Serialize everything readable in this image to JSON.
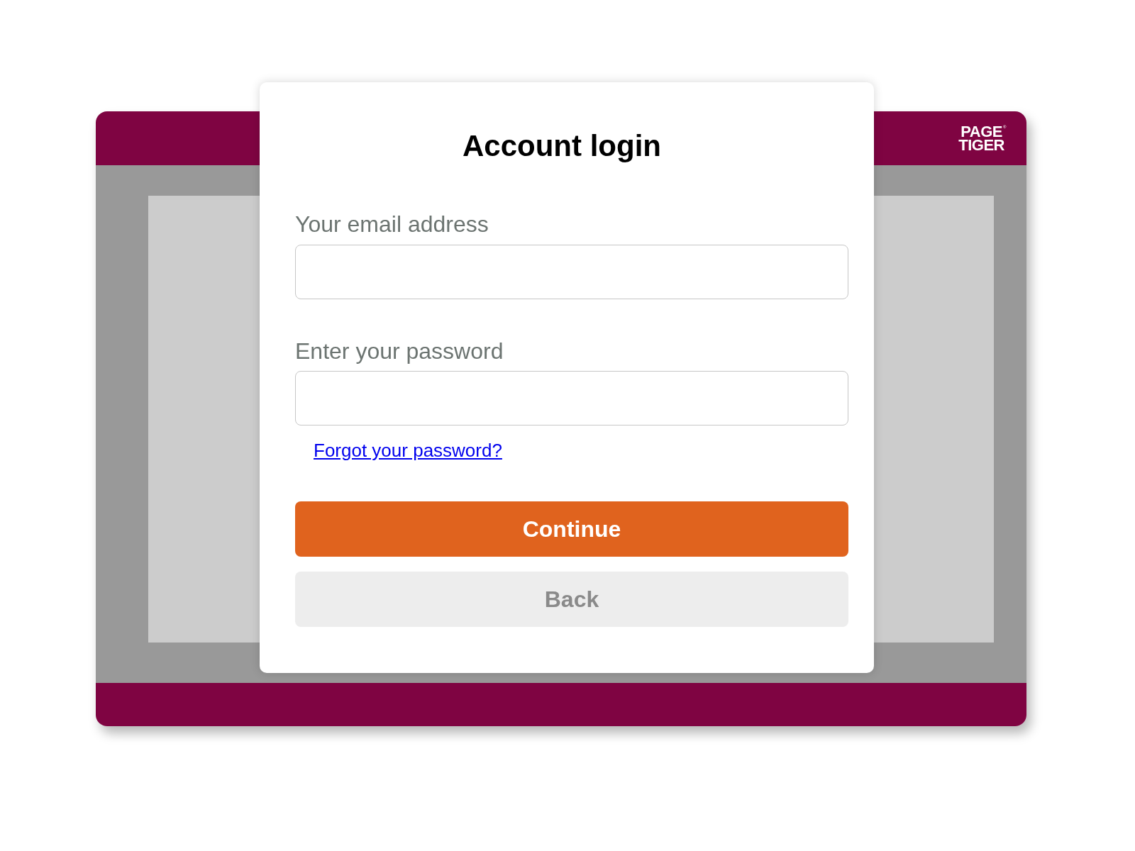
{
  "backdrop": {
    "logo": {
      "lines": [
        "PAGE",
        "TIGER"
      ],
      "mark": "®"
    }
  },
  "dialog": {
    "title": "Account login",
    "fields": [
      {
        "label": "Your email address"
      },
      {
        "label": "Enter your password"
      }
    ],
    "forgot_link": "Forgot your password?",
    "buttons": [
      {
        "label": "Continue",
        "kind": "primary"
      },
      {
        "label": "Back",
        "kind": "secondary"
      }
    ]
  }
}
